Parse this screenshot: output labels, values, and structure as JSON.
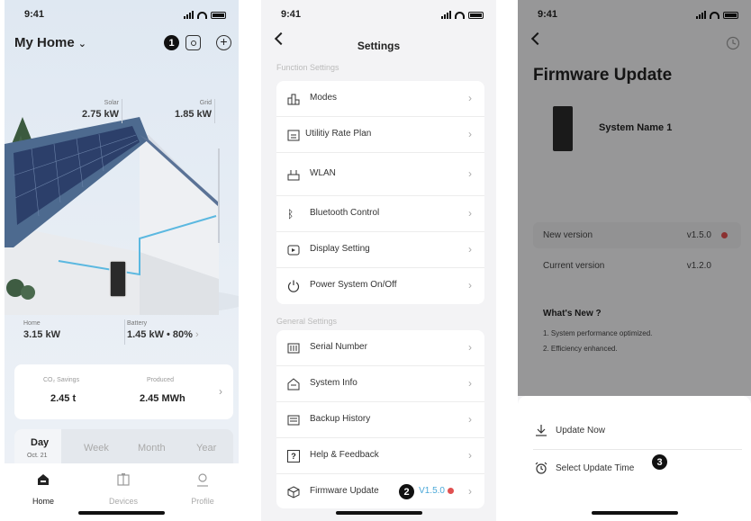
{
  "status": {
    "time": "9:41"
  },
  "screen_home": {
    "title": "My Home",
    "badge": "1",
    "stats": {
      "solar": {
        "label": "Solar",
        "value": "2.75 kW"
      },
      "grid": {
        "label": "Grid",
        "value": "1.85 kW"
      },
      "home": {
        "label": "Home",
        "value": "3.15 kW"
      },
      "battery": {
        "label": "Battery",
        "value": "1.45 kW • 80%"
      }
    },
    "summary": {
      "co2_label": "CO₂ Savings",
      "co2_value": "2.45 t",
      "produced_label": "Produced",
      "produced_value": "2.45 MWh"
    },
    "period": {
      "selected": "Day",
      "date": "Oct. 21",
      "options": [
        "Week",
        "Month",
        "Year"
      ]
    },
    "tabs": [
      {
        "label": "Home",
        "icon": "house-icon"
      },
      {
        "label": "Devices",
        "icon": "devices-icon"
      },
      {
        "label": "Profile",
        "icon": "profile-icon"
      }
    ]
  },
  "screen_settings": {
    "title": "Settings",
    "function_header": "Function Settings",
    "function_items": [
      {
        "label": "Modes",
        "icon": "modes-icon"
      },
      {
        "label": "Utilitiy Rate Plan",
        "icon": "rate-plan-icon"
      },
      {
        "label": "WLAN",
        "icon": "wlan-icon"
      },
      {
        "label": "Bluetooth Control",
        "icon": "bluetooth-icon"
      },
      {
        "label": "Display Setting",
        "icon": "display-icon"
      },
      {
        "label": "Power System On/Off",
        "icon": "power-icon"
      }
    ],
    "general_header": "General Settings",
    "general_items": [
      {
        "label": "Serial Number",
        "icon": "barcode-icon"
      },
      {
        "label": "System Info",
        "icon": "system-info-icon"
      },
      {
        "label": "Backup History",
        "icon": "history-icon"
      },
      {
        "label": "Help & Feedback",
        "icon": "help-icon"
      },
      {
        "label": "Firmware Update",
        "icon": "firmware-icon"
      }
    ],
    "firmware_version": "V1.5.0",
    "badge": "2"
  },
  "screen_firmware": {
    "title": "Firmware Update",
    "device_name": "System Name 1",
    "new_version_label": "New version",
    "new_version_value": "v1.5.0",
    "current_version_label": "Current version",
    "current_version_value": "v1.2.0",
    "whats_new_title": "What's New ?",
    "whats_new_items": [
      "1. System performance optimized.",
      "2. Efficiency enhanced."
    ],
    "sheet": {
      "update_now": "Update Now",
      "select_time": "Select Update Time"
    },
    "badge": "3"
  },
  "colors": {
    "accent": "#4aa8d8",
    "alert": "#e05050",
    "dark": "#111111"
  }
}
